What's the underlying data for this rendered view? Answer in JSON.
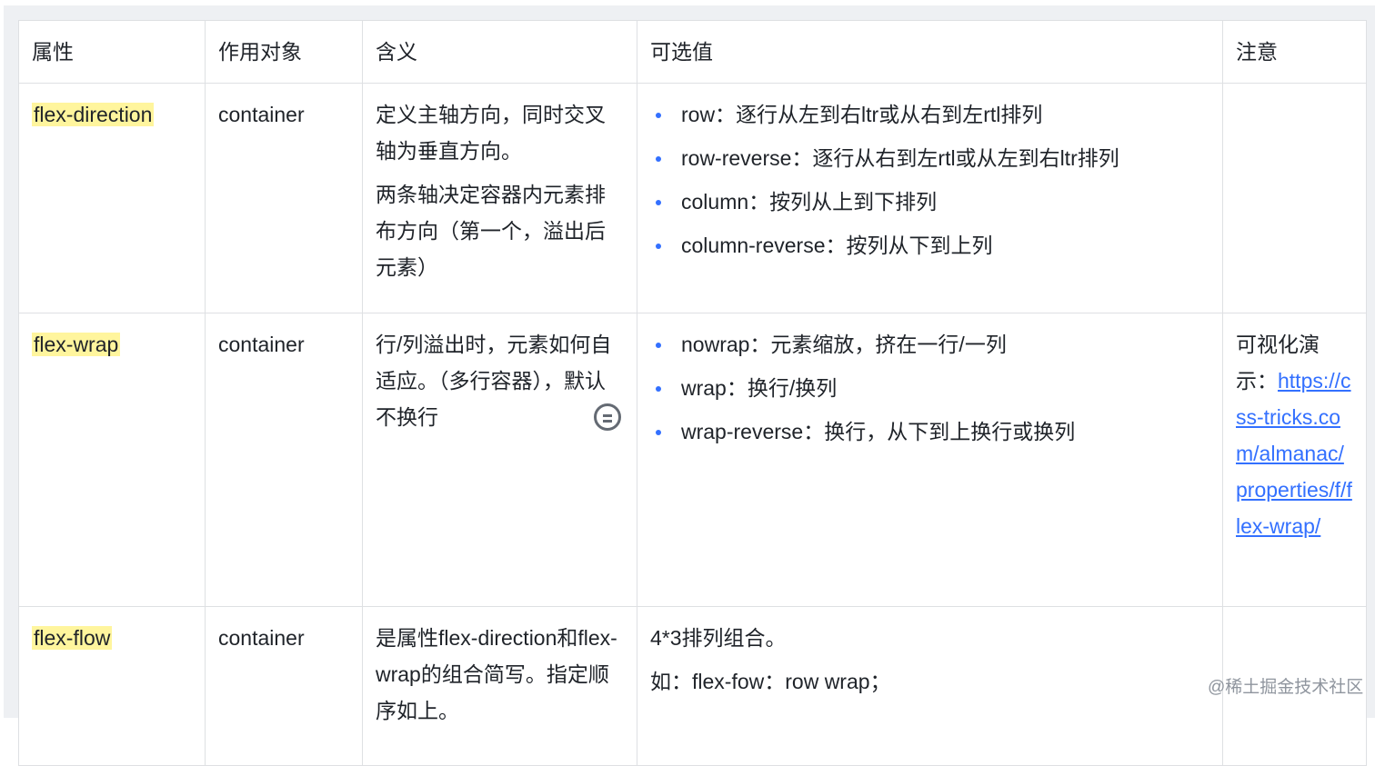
{
  "headers": [
    "属性",
    "作用对象",
    "含义",
    "可选值",
    "注意"
  ],
  "rows": [
    {
      "property": "flex-direction",
      "target": "container",
      "meaning": [
        "定义主轴方向，同时交叉轴为垂直方向。",
        "两条轴决定容器内元素排布方向（第一个，溢出后元素）"
      ],
      "options": [
        "row：逐行从左到右ltr或从右到左rtl排列",
        "row-reverse：逐行从右到左rtl或从左到右ltr排列",
        "column：按列从上到下排列",
        "column-reverse：按列从下到上列"
      ],
      "note_text": "",
      "note_link": ""
    },
    {
      "property": "flex-wrap",
      "target": "container",
      "meaning": [
        "行/列溢出时，元素如何自适应。（多行容器），默认不换行"
      ],
      "options": [
        "nowrap：元素缩放，挤在一行/一列",
        "wrap：换行/换列",
        "wrap-reverse：换行，从下到上换行或换列"
      ],
      "note_text": "可视化演示：",
      "note_link": "https://css-tricks.com/almanac/properties/f/flex-wrap/"
    },
    {
      "property": "flex-flow",
      "target": "container",
      "meaning": [
        "是属性flex-direction和flex-wrap的组合简写。指定顺序如上。"
      ],
      "options_text": [
        "4*3排列组合。",
        "如：flex-fow：row wrap；"
      ],
      "note_text": "",
      "note_link": ""
    }
  ],
  "watermark": "@稀土掘金技术社区",
  "icons": {
    "cell_toggle": "list-toggle-icon"
  },
  "colors": {
    "highlight": "#fff59d",
    "link": "#3370ff",
    "bullet": "#3370ff",
    "border": "#dee0e3"
  }
}
